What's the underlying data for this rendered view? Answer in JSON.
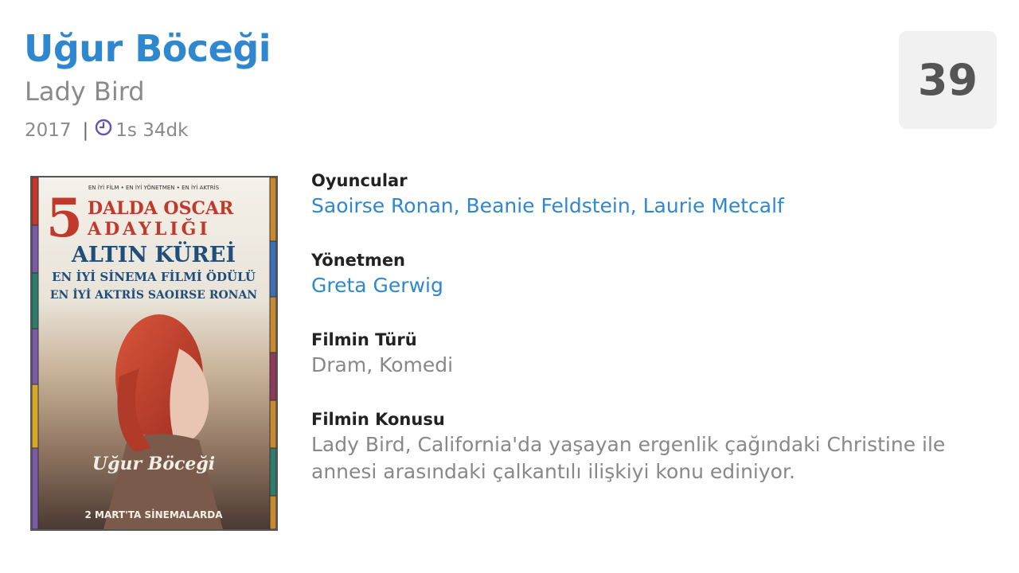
{
  "movie": {
    "title": "Uğur Böceği",
    "original_title": "Lady Bird",
    "year": "2017",
    "separator": "|",
    "duration": "1s 34dk",
    "score": "39"
  },
  "poster": {
    "top_small": "EN İYİ FİLM • EN İYİ YÖNETMEN • EN İYİ AKTRİS",
    "big_number": "5",
    "line1": "DALDA OSCAR",
    "line2": "ADAYLIĞI",
    "line3": "ALTIN KÜREİ",
    "line4": "EN İYİ SİNEMA FİLMİ ÖDÜLÜ",
    "line5": "EN İYİ AKTRİS SAOIRSE RONAN",
    "logo_text": "Uğur Böceği",
    "bottom": "2 MART'TA SİNEMALARDA"
  },
  "details": {
    "cast_label": "Oyuncular",
    "cast": [
      "Saoirse Ronan",
      "Beanie Feldstein",
      "Laurie Metcalf"
    ],
    "director_label": "Yönetmen",
    "director": "Greta Gerwig",
    "genre_label": "Filmin Türü",
    "genre": "Dram, Komedi",
    "plot_label": "Filmin Konusu",
    "plot": "Lady Bird, California'da yaşayan ergenlik çağındaki Christine ile annesi arasındaki çalkantılı ilişkiyi konu ediniyor."
  },
  "colors": {
    "accent": "#2f87cf",
    "muted": "#8a8a8a",
    "clock_icon": "#6a4fb3"
  },
  "icons": {
    "duration": "clock-icon"
  }
}
